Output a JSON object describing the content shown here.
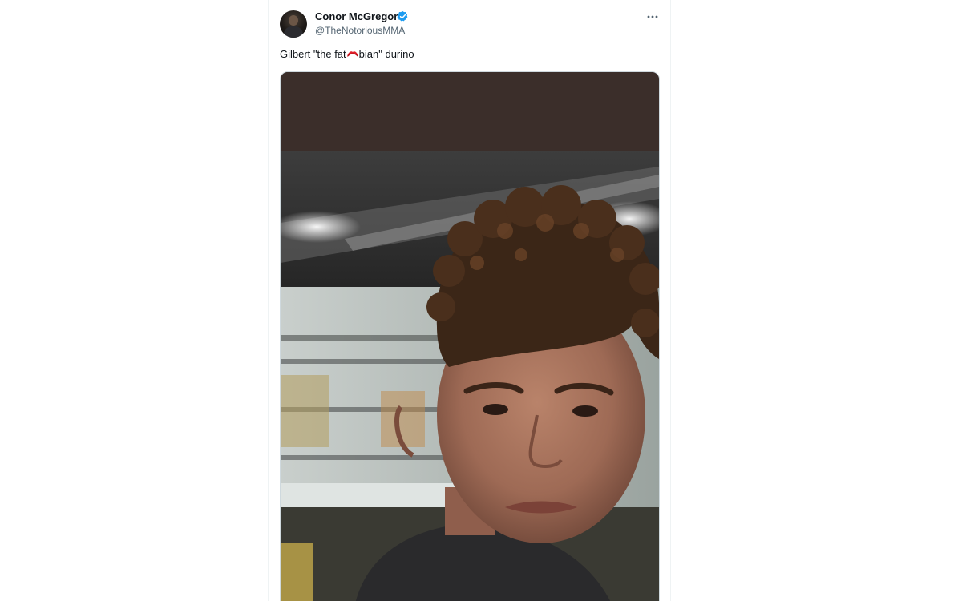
{
  "tweet": {
    "author": {
      "display_name": "Conor McGregor",
      "handle": "@TheNotoriousMMA",
      "verified": true,
      "avatar_icon": "profile-photo"
    },
    "text_before": "Gilbert \"the fat ",
    "text_redacted_icon": "red-redaction-scribble",
    "text_after": "bian\" durino",
    "more_icon": "more-options-icon",
    "media": {
      "type": "video",
      "icon": "video-frame"
    }
  },
  "colors": {
    "text_primary": "#0f1419",
    "text_secondary": "#536471",
    "verified_blue": "#1d9bf0",
    "redaction_red": "#e0202a",
    "media_band": "#3b2e2a"
  }
}
